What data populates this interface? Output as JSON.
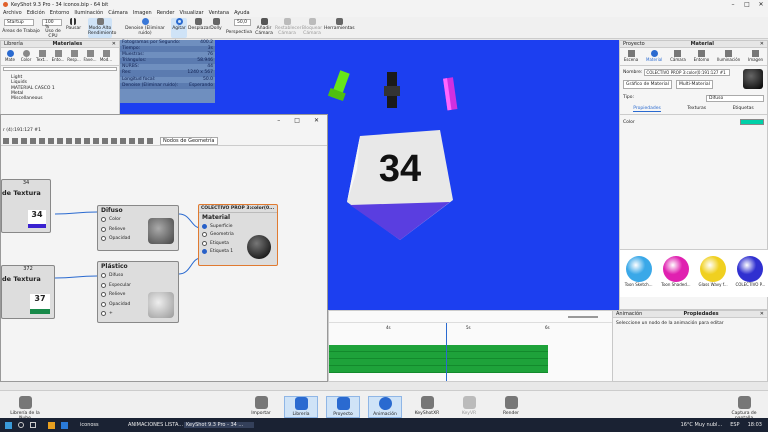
{
  "app": {
    "title": "KeyShot 9.3 Pro - 34 iconos.bip - 64 bit"
  },
  "menu": [
    "Archivo",
    "Edición",
    "Entorno",
    "Iluminación",
    "Cámara",
    "Imagen",
    "Render",
    "Visualizar",
    "Ventana",
    "Ayuda"
  ],
  "toolbar": {
    "workspace": "Startup",
    "workspace_label": "Áreas de Trabajo",
    "cpu_value": "100 %",
    "cpu_label": "Uso de CPU",
    "pause": "Pausar",
    "mode": "Modo Alto Rendimiento",
    "denoise": "Denoise (Eliminar ruido)",
    "reload": "Agitar",
    "pan": "Desplazar",
    "dolly": "Dolly",
    "persp_value": "50,0",
    "persp": "Perspectiva",
    "add_camera": "Añadir Cámara",
    "geom_anim": "Restablecer Cámara",
    "lock_cam": "Bloquear Cámara",
    "tools": "Herramientas"
  },
  "library": {
    "title": "Librería",
    "materials": "Materiales",
    "tabs": [
      "Mate",
      "Color",
      "Text...",
      "Ento...",
      "Resp...",
      "Fave...",
      "Mod..."
    ],
    "tree": [
      "Light",
      "Liquids",
      "MATERIAL CASCO 1",
      "Metal",
      "Miscellaneous"
    ]
  },
  "stats": [
    [
      "Fotogramas por Segundo:",
      "400.2"
    ],
    [
      "Tiempo:",
      "3s"
    ],
    [
      "Muestras:",
      "76"
    ],
    [
      "Triángulos:",
      "58.946"
    ],
    [
      "NURBS:",
      "44"
    ],
    [
      "Res:",
      "1240 x 567"
    ],
    [
      "Longitud focal:",
      "50.0"
    ],
    [
      "Denoise (Eliminar ruido):",
      "Esperando"
    ]
  ],
  "die_number": "34",
  "node_editor": {
    "material_path": "r (4):191:127 #1",
    "nodes_btn": "Nodos de Geometría",
    "tex1_num": "34",
    "tex1_label": "de Textura",
    "tex1_value": "34",
    "tex2_num": "372",
    "tex2_label": "de Textura",
    "tex2_value": "37",
    "difuso": {
      "title": "Difuso",
      "ports": [
        "Color",
        "Relieve",
        "Opacidad"
      ]
    },
    "plastico": {
      "title": "Plástico",
      "ports": [
        "Difuso",
        "Especular",
        "Relieve",
        "Opacidad",
        "+"
      ]
    },
    "material": {
      "header": "COLECTIVO PROP 3:color(0...",
      "title": "Material",
      "ports": [
        "Superficie",
        "Geometría",
        "Etiqueta",
        "Etiqueta 1"
      ]
    }
  },
  "timeline": {
    "marks": [
      "4s",
      "5s",
      "6s"
    ]
  },
  "project": {
    "title": "Proyecto",
    "tab": "Material",
    "tabs": [
      "Escena",
      "Material",
      "Cámara",
      "Entorno",
      "Iluminación",
      "Imagen"
    ],
    "name_label": "Nombre:",
    "name_value": "COLECTIVO PROP 3:color(0:191:127 #1",
    "graph_btn": "Gráfico de Material",
    "multi_btn": "Multi-Material",
    "type_label": "Tipo:",
    "type_value": "Difuso",
    "subtabs": [
      "Propiedades",
      "Texturas",
      "Etiquetas"
    ],
    "color_label": "Color",
    "color_value": "#00d0a8"
  },
  "thumbs": [
    {
      "name": "Toon Sketch...",
      "color": "#3aa8e8"
    },
    {
      "name": "Toon Shaded...",
      "color": "#e020b0"
    },
    {
      "name": "Glass Wavy f...",
      "color": "#f0d020"
    },
    {
      "name": "COLECTIVO P...",
      "color": "#3030d0"
    }
  ],
  "animation": {
    "title": "Animación",
    "props": "Propiedades",
    "message": "Seleccione un nodo de la animación para editar"
  },
  "dock": {
    "cloud": "Librería de la Nube",
    "import": "Importar",
    "library": "Librería",
    "project": "Proyecto",
    "animation": "Animación",
    "keyshotxr": "KeyShotXR",
    "keyvr": "KeyVR",
    "render": "Render",
    "capture": "Captura de pantalla"
  },
  "taskbar": {
    "items": [
      "iconoss",
      "ANIMACIONES LISTA...",
      "KeyShot 9.3 Pro - 34 ..."
    ],
    "weather": "16°C  Muy nubl...",
    "lang": "ESP",
    "time": "18:03"
  }
}
